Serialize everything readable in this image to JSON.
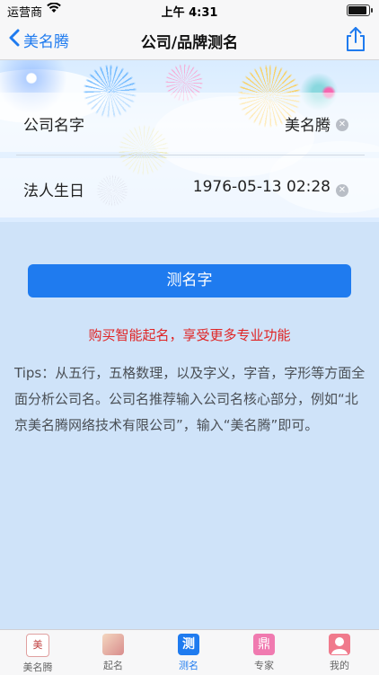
{
  "status": {
    "carrier": "运营商",
    "time": "上午 4:31"
  },
  "nav": {
    "back_label": "美名腾",
    "title": "公司/品牌测名"
  },
  "form": {
    "company_label": "公司名字",
    "company_value": "美名腾",
    "birthday_label": "法人生日",
    "birthday_value": "1976-05-13 02:28"
  },
  "actions": {
    "test_button": "测名字",
    "promo": "购买智能起名，享受更多专业功能"
  },
  "tips": "Tips：从五行，五格数理，以及字义，字音，字形等方面全面分析公司名。公司名推荐输入公司名核心部分，例如“北京美名腾网络技术有限公司”，输入“美名腾”即可。",
  "tabbar": {
    "items": [
      {
        "label": "美名腾",
        "icon": "meimingteng-logo-icon"
      },
      {
        "label": "起名",
        "icon": "naming-icon"
      },
      {
        "label": "测名",
        "icon": "test-name-icon",
        "active": true
      },
      {
        "label": "专家",
        "icon": "expert-icon"
      },
      {
        "label": "我的",
        "icon": "profile-icon"
      }
    ],
    "icon_glyphs": {
      "meimingteng": "美",
      "expert": "鼎",
      "test": "测"
    }
  },
  "colors": {
    "accent": "#1f7bef",
    "promo": "#e02424",
    "background": "#cfe3f9"
  }
}
